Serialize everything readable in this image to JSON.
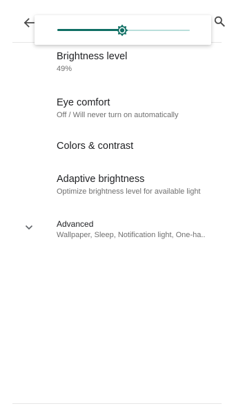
{
  "app_bar": {
    "back_icon": "arrow-back-icon",
    "search_icon": "search-icon"
  },
  "brightness_popup": {
    "level_fraction": 0.49,
    "active_color": "#0f6f64",
    "inactive_color": "#b9dfdb",
    "thumb_icon": "brightness-sun-icon"
  },
  "settings": {
    "brightness_level": {
      "title": "Brightness level",
      "summary": "49%"
    },
    "eye_comfort": {
      "title": "Eye comfort",
      "summary": "Off / Will never turn on automatically"
    },
    "colors_contrast": {
      "title": "Colors & contrast"
    },
    "adaptive_brightness": {
      "title": "Adaptive brightness",
      "summary": "Optimize brightness level for available light"
    },
    "advanced": {
      "title": "Advanced",
      "summary": "Wallpaper, Sleep, Notification light, One-ha..",
      "icon": "chevron-down-icon"
    }
  }
}
